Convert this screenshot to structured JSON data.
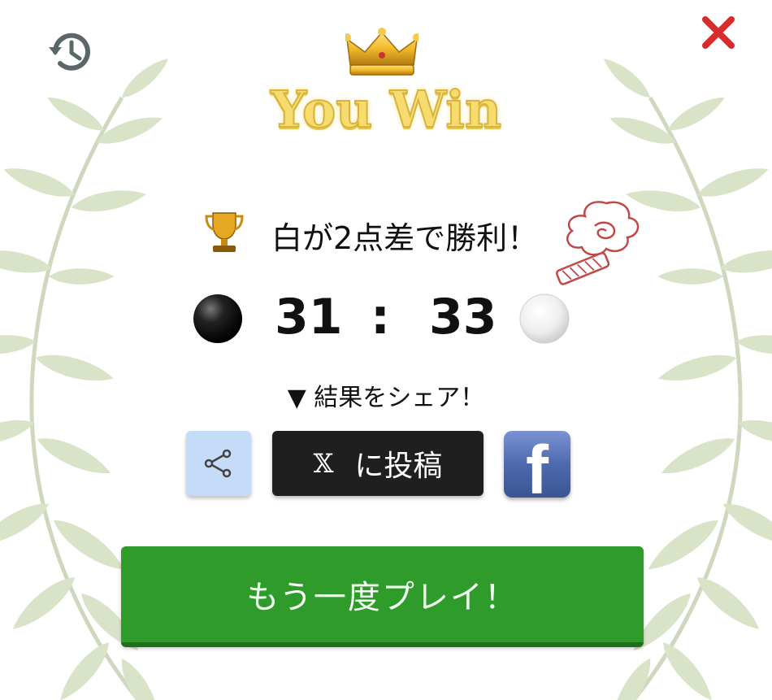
{
  "header": {
    "title": "You Win",
    "history_icon": "history-icon",
    "close_icon": "close-icon",
    "crown_icon": "crown-icon"
  },
  "result": {
    "text": "白が2点差で勝利！",
    "trophy_icon": "trophy-icon"
  },
  "score": {
    "black": "31",
    "separator": ":",
    "white": "33"
  },
  "share": {
    "label": "▼ 結果をシェア！",
    "x_logo": "𝕏",
    "x_label": "に投稿",
    "facebook_letter": "f"
  },
  "actions": {
    "replay_label": "もう一度プレイ！"
  },
  "colors": {
    "title_gold": "#f6dc6e",
    "replay_green": "#2f9b2b",
    "close_red": "#d92b2b",
    "share_blue": "#c4dcf7",
    "x_black": "#1f1f1f",
    "facebook_blue": "#4e69ad"
  }
}
